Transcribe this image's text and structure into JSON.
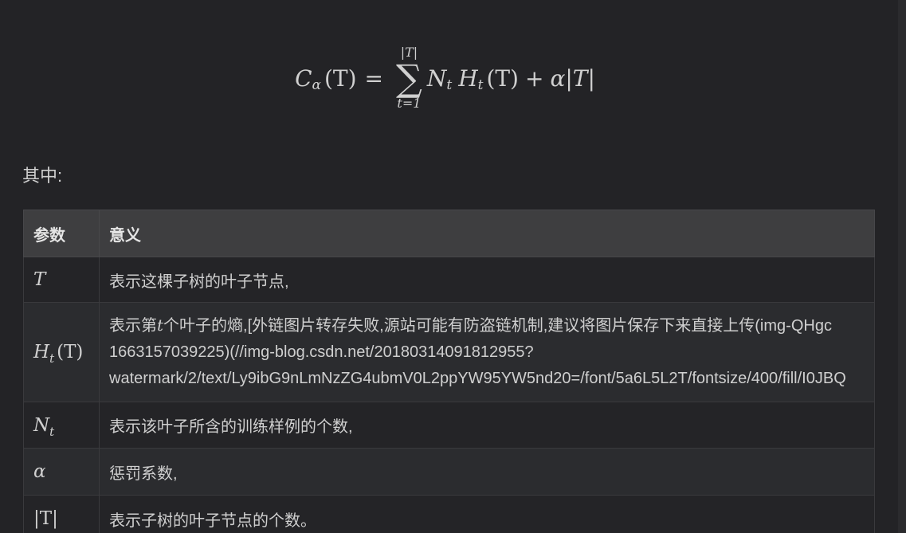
{
  "formula": {
    "lhs_symbol": "C",
    "lhs_subscript": "α",
    "lhs_arg": "(T)",
    "equals": "=",
    "sum_upper": "|T|",
    "sum_symbol": "∑",
    "sum_lower": "t=1",
    "term1_symbol": "N",
    "term1_subscript": "t",
    "term2_symbol": "H",
    "term2_subscript": "t",
    "term2_arg": "(T)",
    "plus": "+",
    "penalty": "α|T|"
  },
  "intro": "其中:",
  "table": {
    "headers": [
      "参数",
      "意义"
    ],
    "rows": [
      {
        "symbol": "T",
        "lines": [
          "表示这棵子树的叶子节点,"
        ]
      },
      {
        "symbol": "H",
        "symbol_subscript": "t",
        "symbol_arg": "(T)",
        "line1_before": "表示第",
        "line1_math": "t",
        "line1_after": "个叶子的熵,[外链图片转存失败,源站可能有防盗链机制,建议将图片保存下来直接上传(img-QHgc",
        "lines": [
          "1663157039225)(//img-blog.csdn.net/20180314091812955?",
          "watermark/2/text/Ly9ibG9nLmNzZG4ubmV0L2ppYW95YW5nd20=/font/5a6L5L2T/fontsize/400/fill/I0JBQ"
        ]
      },
      {
        "symbol": "N",
        "symbol_subscript": "t",
        "lines": [
          "表示该叶子所含的训练样例的个数,"
        ]
      },
      {
        "symbol": "α",
        "lines": [
          "惩罚系数,"
        ]
      },
      {
        "symbol": "|T|",
        "lines": [
          "表示子树的叶子节点的个数。"
        ]
      }
    ]
  }
}
